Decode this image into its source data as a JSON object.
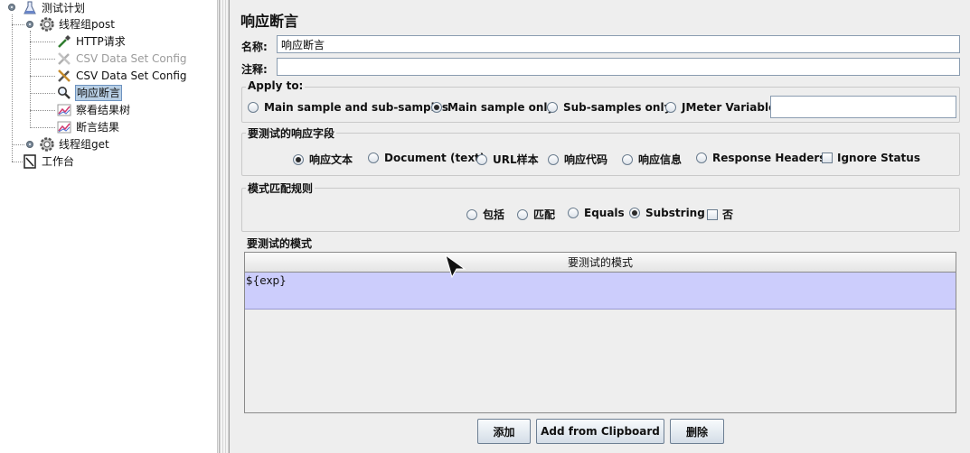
{
  "tree": {
    "items": [
      {
        "label": "测试计划",
        "icon": "flask-icon"
      },
      {
        "label": "线程组post",
        "icon": "gear-icon"
      },
      {
        "label": "HTTP请求",
        "icon": "pipette-icon"
      },
      {
        "label": "CSV Data Set Config",
        "icon": "wrench-icon",
        "disabled": true
      },
      {
        "label": "CSV Data Set Config",
        "icon": "wrench-icon"
      },
      {
        "label": "响应断言",
        "icon": "magnifier-icon",
        "selected": true
      },
      {
        "label": "察看结果树",
        "icon": "graph-icon"
      },
      {
        "label": "断言结果",
        "icon": "graph-icon"
      },
      {
        "label": "线程组get",
        "icon": "gear-icon"
      },
      {
        "label": "工作台",
        "icon": "clipboard-icon"
      }
    ]
  },
  "panel": {
    "title": "响应断言",
    "name_label": "名称:",
    "name_value": "响应断言",
    "comment_label": "注释:",
    "comment_value": "",
    "apply_to": {
      "title": "Apply to:",
      "options": [
        "Main sample and sub-samples",
        "Main sample only",
        "Sub-samples only",
        "JMeter Variable"
      ],
      "selected": "Main sample only",
      "variable_value": ""
    },
    "response_field": {
      "title": "要测试的响应字段",
      "options": [
        "响应文本",
        "Document (text)",
        "URL样本",
        "响应代码",
        "响应信息",
        "Response Headers"
      ],
      "selected": "响应文本",
      "ignore_status_label": "Ignore Status",
      "ignore_status_checked": false
    },
    "pattern_rules": {
      "title": "模式匹配规则",
      "options": [
        "包括",
        "匹配",
        "Equals",
        "Substring"
      ],
      "selected": "Substring",
      "not_label": "否",
      "not_checked": false
    },
    "patterns": {
      "title": "要测试的模式",
      "column_header": "要测试的模式",
      "rows": [
        "${exp}"
      ]
    },
    "buttons": {
      "add": "添加",
      "add_clipboard": "Add from Clipboard",
      "delete": "删除"
    }
  },
  "colors": {
    "selected_row": "#cccdfc",
    "tree_selection": "#b8cfe5"
  }
}
